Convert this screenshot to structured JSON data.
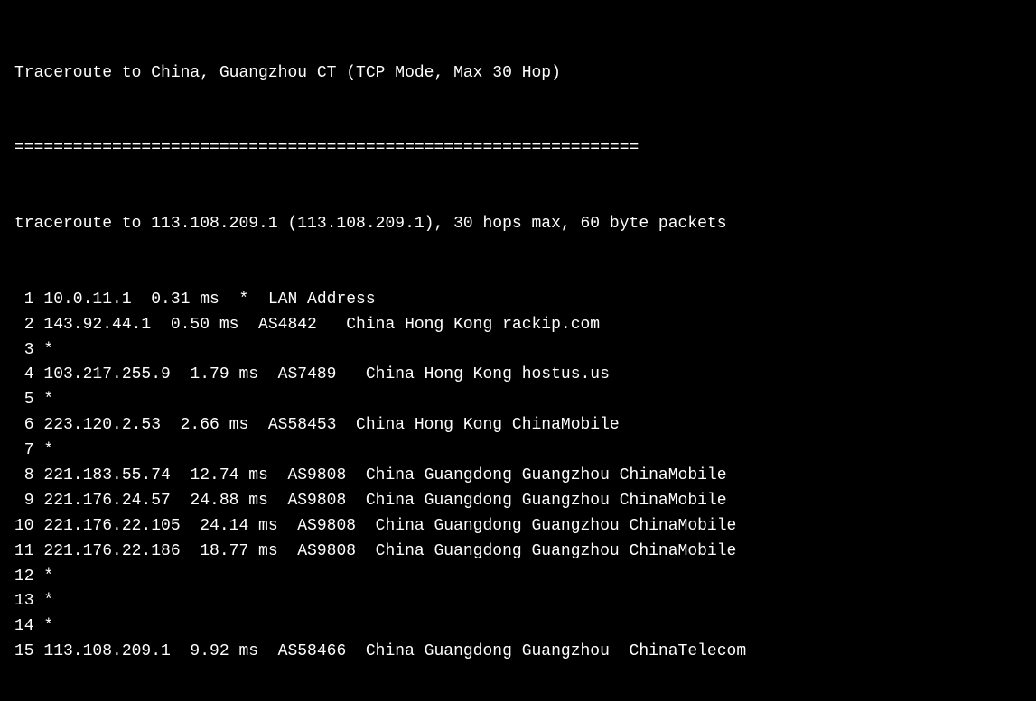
{
  "terminal": {
    "title_line": "Traceroute to China, Guangzhou CT (TCP Mode, Max 30 Hop)",
    "separator": "================================================================",
    "traceroute_cmd": "traceroute to 113.108.209.1 (113.108.209.1), 30 hops max, 60 byte packets",
    "hops": [
      {
        "num": " 1",
        "content": " 10.0.11.1  0.31 ms  *  LAN Address"
      },
      {
        "num": " 2",
        "content": " 143.92.44.1  0.50 ms  AS4842   China Hong Kong rackip.com"
      },
      {
        "num": " 3",
        "content": " *"
      },
      {
        "num": " 4",
        "content": " 103.217.255.9  1.79 ms  AS7489   China Hong Kong hostus.us"
      },
      {
        "num": " 5",
        "content": " *"
      },
      {
        "num": " 6",
        "content": " 223.120.2.53  2.66 ms  AS58453  China Hong Kong ChinaMobile"
      },
      {
        "num": " 7",
        "content": " *"
      },
      {
        "num": " 8",
        "content": " 221.183.55.74  12.74 ms  AS9808  China Guangdong Guangzhou ChinaMobile"
      },
      {
        "num": " 9",
        "content": " 221.176.24.57  24.88 ms  AS9808  China Guangdong Guangzhou ChinaMobile"
      },
      {
        "num": "10",
        "content": " 221.176.22.105  24.14 ms  AS9808  China Guangdong Guangzhou ChinaMobile"
      },
      {
        "num": "11",
        "content": " 221.176.22.186  18.77 ms  AS9808  China Guangdong Guangzhou ChinaMobile"
      },
      {
        "num": "12",
        "content": " *"
      },
      {
        "num": "13",
        "content": " *"
      },
      {
        "num": "14",
        "content": " *"
      },
      {
        "num": "15",
        "content": " 113.108.209.1  9.92 ms  AS58466  China Guangdong Guangzhou  ChinaTelecom"
      }
    ]
  }
}
